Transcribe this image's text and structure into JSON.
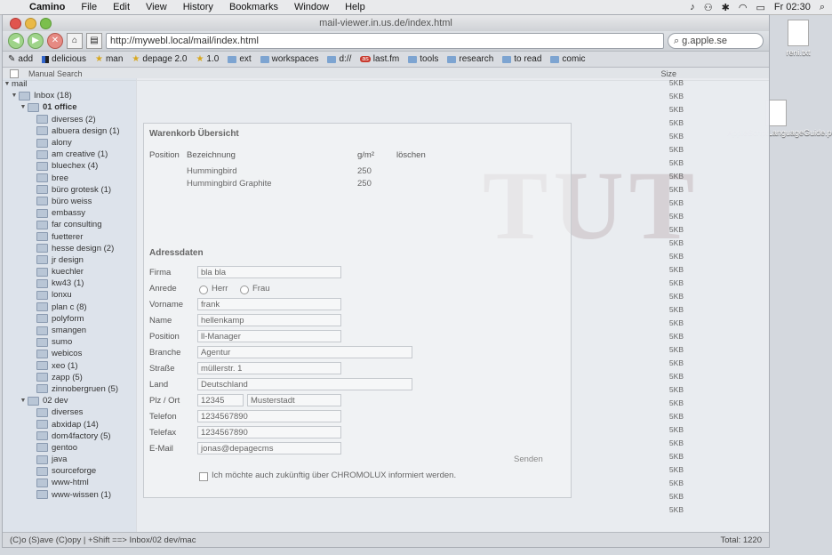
{
  "menubar": {
    "app": "Camino",
    "items": [
      "File",
      "Edit",
      "View",
      "History",
      "Bookmarks",
      "Window",
      "Help"
    ],
    "clock": "Fr 02:30"
  },
  "window": {
    "title": "mail-viewer.in.us.de/index.html",
    "url": "http://mywebl.local/mail/index.html",
    "search": "g.apple.se"
  },
  "bookmarks": [
    {
      "label": "add",
      "icon": "plus-icon"
    },
    {
      "label": "delicious",
      "icon": "delicious-icon"
    },
    {
      "label": "man",
      "icon": "star-icon"
    },
    {
      "label": "depage 2.0",
      "icon": "star-icon"
    },
    {
      "label": "1.0",
      "icon": "star-icon"
    },
    {
      "label": "ext",
      "icon": "folder-icon"
    },
    {
      "label": "workspaces",
      "icon": "folder-icon"
    },
    {
      "label": "d://",
      "icon": "folder-icon"
    },
    {
      "label": "last.fm",
      "icon": "lastfm-icon"
    },
    {
      "label": "tools",
      "icon": "folder-icon"
    },
    {
      "label": "research",
      "icon": "folder-icon"
    },
    {
      "label": "to read",
      "icon": "folder-icon"
    },
    {
      "label": "comic",
      "icon": "folder-icon"
    }
  ],
  "mailbar": {
    "left": "Manual Search",
    "right": "Size"
  },
  "sidebar": {
    "root": "mail",
    "inbox": "Inbox (18)",
    "office": "01 office",
    "office_items": [
      "diverses (2)",
      "albuera design (1)",
      "alony",
      "am creative (1)",
      "bluechex (4)",
      "bree",
      "büro grotesk (1)",
      "büro weiss",
      "embassy",
      "far consulting",
      "fuetterer",
      "hesse design (2)",
      "jr design",
      "kuechler",
      "kw43 (1)",
      "lonxu",
      "plan c (8)",
      "polyform",
      "smangen",
      "sumo",
      "webicos",
      "xeo (1)",
      "zapp (5)",
      "zinnobergruen (5)"
    ],
    "dev": "02 dev",
    "dev_items": [
      "diverses",
      "abxidap (14)",
      "dom4factory (5)",
      "gentoo",
      "java",
      "sourceforge",
      "www-html",
      "www-wissen (1)"
    ]
  },
  "form": {
    "section1": "Warenkorb Übersicht",
    "col_pos": "Position",
    "col_bez": "Bezeichnung",
    "col_menge": "g/m²",
    "col_loeschen": "löschen",
    "row1": "Hummingbird",
    "row1_val": "250",
    "row2": "Hummingbird Graphite",
    "row2_val": "250",
    "section2": "Adressdaten",
    "firma_lbl": "Firma",
    "firma_val": "bla bla",
    "anrede_lbl": "Anrede",
    "anrede_herr": "Herr",
    "anrede_frau": "Frau",
    "vorname_lbl": "Vorname",
    "vorname_val": "frank",
    "name_lbl": "Name",
    "name_val": "hellenkamp",
    "position_lbl": "Position",
    "position_val": "ll-Manager",
    "branche_lbl": "Branche",
    "branche_val": "Agentur",
    "strasse_lbl": "Straße",
    "strasse_val": "müllerstr. 1",
    "land_lbl": "Land",
    "land_val": "Deutschland",
    "plz_lbl": "Plz / Ort",
    "plz_val": "12345",
    "ort_val": "Musterstadt",
    "telefon_lbl": "Telefon",
    "telefon_val": "1234567890",
    "telefax_lbl": "Telefax",
    "telefax_val": "1234567890",
    "email_lbl": "E-Mail",
    "email_val": "jonas@depagecms",
    "newsletter": "Ich möchte auch zukünftig über CHROMOLUX informiert werden.",
    "senden": "Senden"
  },
  "sizes": [
    "5KB",
    "5KB",
    "5KB",
    "5KB",
    "5KB",
    "5KB",
    "5KB",
    "5KB",
    "5KB",
    "5KB",
    "5KB",
    "5KB",
    "5KB",
    "5KB",
    "5KB",
    "5KB",
    "5KB",
    "5KB",
    "5KB",
    "5KB",
    "5KB",
    "5KB",
    "5KB",
    "5KB",
    "5KB",
    "5KB",
    "5KB",
    "5KB",
    "5KB",
    "5KB",
    "5KB",
    "5KB",
    "5KB"
  ],
  "statusbar": {
    "left": "(C)o (S)ave (C)opy | +Shift ==> Inbox/02 dev/mac",
    "right": "Total: 1220"
  },
  "desktop": {
    "file1": "reni.txt",
    "file2": "AppleScriptLanguageGuide.pdf"
  }
}
